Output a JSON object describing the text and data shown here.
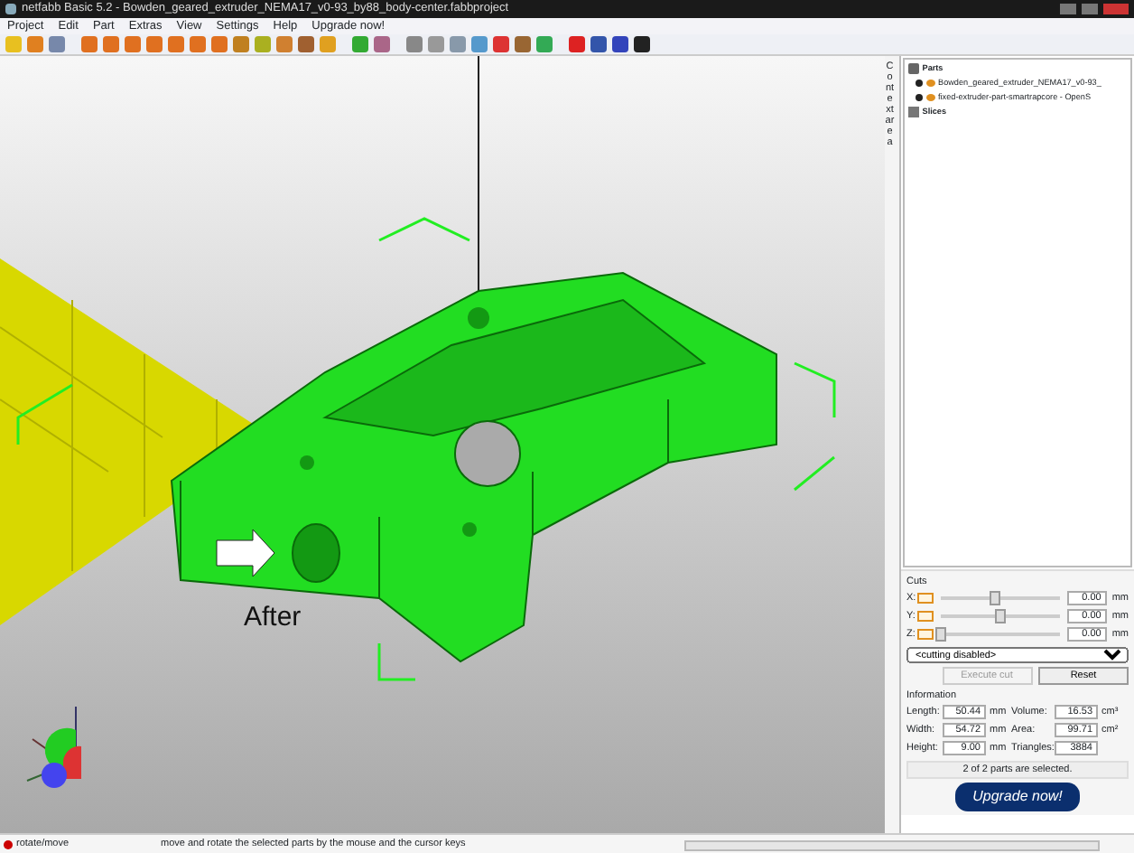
{
  "window": {
    "title": "netfabb Basic 5.2 - Bowden_geared_extruder_NEMA17_v0-93_by88_body-center.fabbproject"
  },
  "menu": [
    "Project",
    "Edit",
    "Part",
    "Extras",
    "View",
    "Settings",
    "Help",
    "Upgrade now!"
  ],
  "side_tab": {
    "label": "Context area"
  },
  "parts_tree": [
    {
      "kind": "group",
      "label": "Parts",
      "children": [
        {
          "kind": "part",
          "label": "Bowden_geared_extruder_NEMA17_v0-93_"
        },
        {
          "kind": "part",
          "label": "fixed-extruder-part-smartrapcore - OpenS"
        }
      ]
    },
    {
      "kind": "slices",
      "label": "Slices"
    }
  ],
  "cuts": {
    "title": "Cuts",
    "axes": [
      {
        "label": "X:",
        "checked": false,
        "level": 0.45,
        "value": "0.00",
        "unit": "mm"
      },
      {
        "label": "Y:",
        "checked": false,
        "level": 0.5,
        "value": "0.00",
        "unit": "mm"
      },
      {
        "label": "Z:",
        "checked": false,
        "level": 0.0,
        "value": "0.00",
        "unit": "mm"
      }
    ],
    "mode": "<cutting disabled>",
    "buttons": [
      {
        "label": "Execute cut",
        "disabled": true
      },
      {
        "label": "Reset",
        "disabled": false
      }
    ]
  },
  "information": {
    "title": "Information",
    "rows": [
      {
        "label": "Length:",
        "value": "50.44",
        "unit": "mm",
        "label_2": "Volume:",
        "value_2": "16.53",
        "unit_2": "cm³"
      },
      {
        "label": "Width:",
        "value": "54.72",
        "unit": "mm",
        "label_2": "Area:",
        "value_2": "99.71",
        "unit_2": "cm²"
      },
      {
        "label": "Height:",
        "value": "9.00",
        "unit": "mm",
        "label_2": "Triangles:",
        "value_2": "3884",
        "unit_2": ""
      }
    ]
  },
  "selection_status": "2 of 2 parts are selected.",
  "upgrade_button": "Upgrade now!",
  "viewport": {
    "callout": "After"
  },
  "status_bar": {
    "mode": "rotate/move",
    "hint": "move and rotate the selected parts by the mouse and the cursor keys",
    "progress": {
      "level": 0
    }
  }
}
